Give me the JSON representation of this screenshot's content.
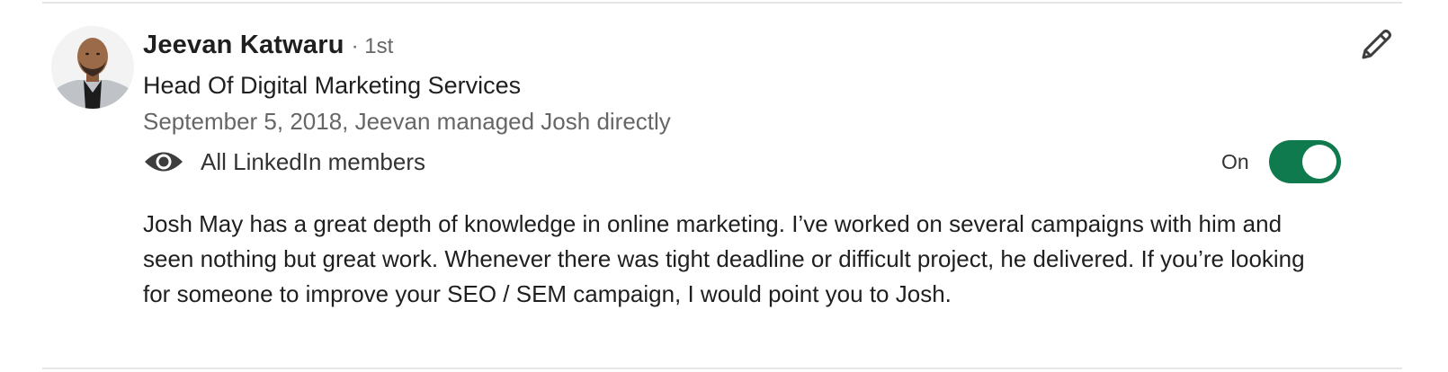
{
  "recommender": {
    "name": "Jeevan Katwaru",
    "degree": "· 1st",
    "headline": "Head Of Digital Marketing Services",
    "meta": "September 5, 2018, Jeevan managed Josh directly"
  },
  "visibility": {
    "icon": "eye-icon",
    "label": "All LinkedIn members"
  },
  "toggle": {
    "label": "On",
    "state": true,
    "color": "#0f7a4d"
  },
  "edit": {
    "icon": "pencil-icon"
  },
  "recommendation": {
    "text": "Josh May has a great depth of knowledge in online marketing. I’ve worked on several campaigns with him and seen nothing but great work. Whenever there was tight deadline or difficult project, he delivered. If you’re looking for someone to improve your SEO / SEM campaign, I would point you to Josh."
  }
}
